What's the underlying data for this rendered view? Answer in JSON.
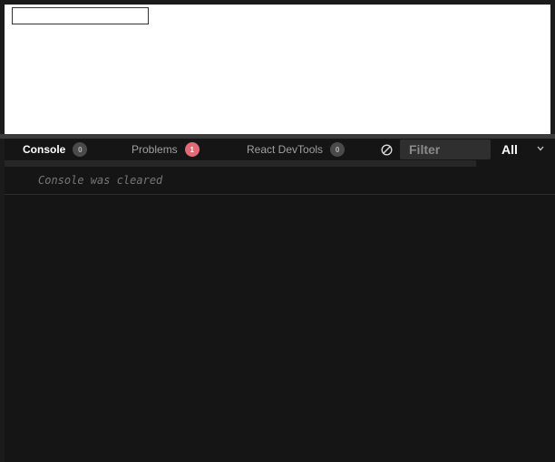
{
  "preview": {
    "input_value": ""
  },
  "tabs": [
    {
      "label": "Console",
      "count": "0",
      "active": true
    },
    {
      "label": "Problems",
      "count": "1",
      "active": false
    },
    {
      "label": "React DevTools",
      "count": "0",
      "active": false
    }
  ],
  "toolbar": {
    "clear_icon": "clear-console-icon",
    "filter_placeholder": "Filter",
    "filter_value": "",
    "level_label": "All",
    "level_icon": "chevron-down-icon"
  },
  "console": {
    "messages": [
      {
        "text": "Console was cleared"
      }
    ]
  },
  "colors": {
    "background": "#151515",
    "problems_badge": "#e06a78",
    "badge": "#4a4a4a",
    "filter_bg": "#2f2f2f"
  }
}
